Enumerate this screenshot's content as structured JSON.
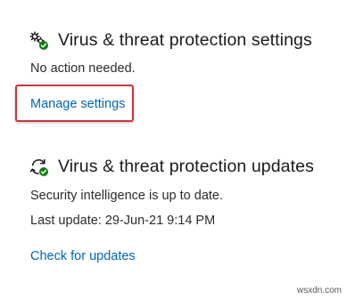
{
  "settings_section": {
    "title": "Virus & threat protection settings",
    "status": "No action needed.",
    "link_label": "Manage settings",
    "icon": "gear-shield-check-icon"
  },
  "updates_section": {
    "title": "Virus & threat protection updates",
    "status_line1": "Security intelligence is up to date.",
    "status_line2": "Last update: 29-Jun-21 9:14 PM",
    "link_label": "Check for updates",
    "icon": "refresh-check-icon"
  },
  "watermark": "wsxdn.com",
  "colors": {
    "link": "#0067b8",
    "highlight": "#c8383f",
    "check_green": "#107c10",
    "text": "#1b1b1b"
  }
}
